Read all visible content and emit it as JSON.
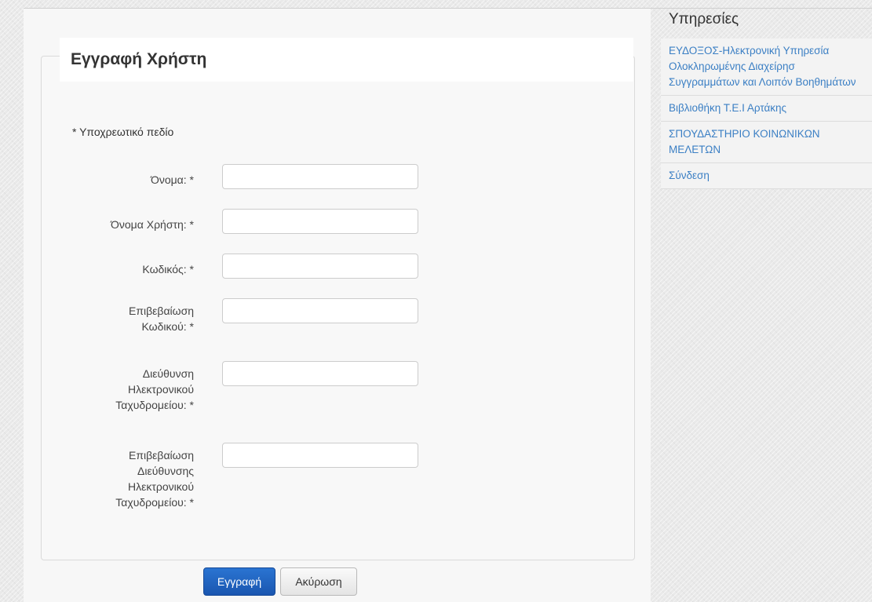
{
  "form": {
    "title": "Εγγραφή Χρήστη",
    "required_note": "* Υποχρεωτικό πεδίο",
    "fields": [
      {
        "label": "Όνομα: *",
        "value": "",
        "placeholder": ""
      },
      {
        "label": "Όνομα Χρήστη: *",
        "value": "",
        "placeholder": ""
      },
      {
        "label": "Κωδικός: *",
        "value": "",
        "placeholder": ""
      },
      {
        "label": "Επιβεβαίωση Κωδικού: *",
        "value": "",
        "placeholder": ""
      },
      {
        "label": "Διεύθυνση Ηλεκτρονικού Ταχυδρομείου: *",
        "value": "",
        "placeholder": ""
      },
      {
        "label": "Επιβεβαίωση Διεύθυνσης Ηλεκτρονικού Ταχυδρομείου: *",
        "value": "",
        "placeholder": ""
      }
    ],
    "submit_label": "Εγγραφή",
    "cancel_label": "Ακύρωση"
  },
  "sidebar": {
    "title": "Υπηρεσίες",
    "items": [
      {
        "label": "ΕΥΔΟΞΟΣ-Ηλεκτρονική Υπηρεσία Ολοκληρωμένης Διαχείρησ Συγγραμμάτων και Λοιπόν Βοηθημάτων"
      },
      {
        "label": "Βιβλιοθήκη Τ.Ε.Ι Αρτάκης"
      },
      {
        "label": "ΣΠΟΥΔΑΣΤΗΡΙΟ ΚΟΙΝΩΝΙΚΩΝ ΜΕΛΕΤΩΝ"
      },
      {
        "label": "Σύνδεση"
      }
    ]
  },
  "colors": {
    "link": "#3b7fc4",
    "primary_button": "#1f63c2",
    "panel_bg": "#f7f7f7"
  }
}
